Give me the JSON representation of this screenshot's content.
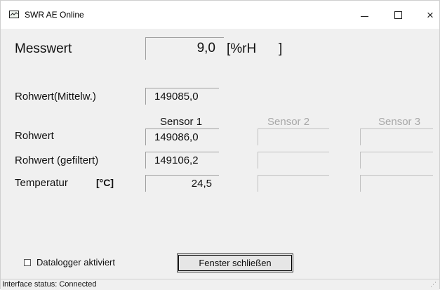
{
  "window": {
    "title": "SWR AE Online",
    "icon": "monitor-chart-icon",
    "controls": {
      "minimize": "minimize",
      "maximize": "maximize",
      "close": "×"
    }
  },
  "measurement": {
    "label": "Messwert",
    "value": "9,0",
    "unit_open": "[%rH",
    "unit_close": "]"
  },
  "raw_mean": {
    "label": "Rohwert(Mittelw.)",
    "value": "149085,0"
  },
  "sensors": {
    "headers": [
      "Sensor 1",
      "Sensor 2",
      "Sensor 3"
    ],
    "rows": [
      {
        "label": "Rohwert",
        "unit": "",
        "values": [
          "149086,0",
          "",
          ""
        ]
      },
      {
        "label": "Rohwert (gefiltert)",
        "unit": "",
        "values": [
          "149106,2",
          "",
          ""
        ]
      },
      {
        "label": "Temperatur",
        "unit": "[°C]",
        "values": [
          "24,5",
          "",
          ""
        ]
      }
    ]
  },
  "datalogger": {
    "label": "Datalogger aktiviert",
    "checked": false
  },
  "close_button": {
    "label": "Fenster schließen"
  },
  "status": {
    "text": "Interface status: Connected"
  }
}
